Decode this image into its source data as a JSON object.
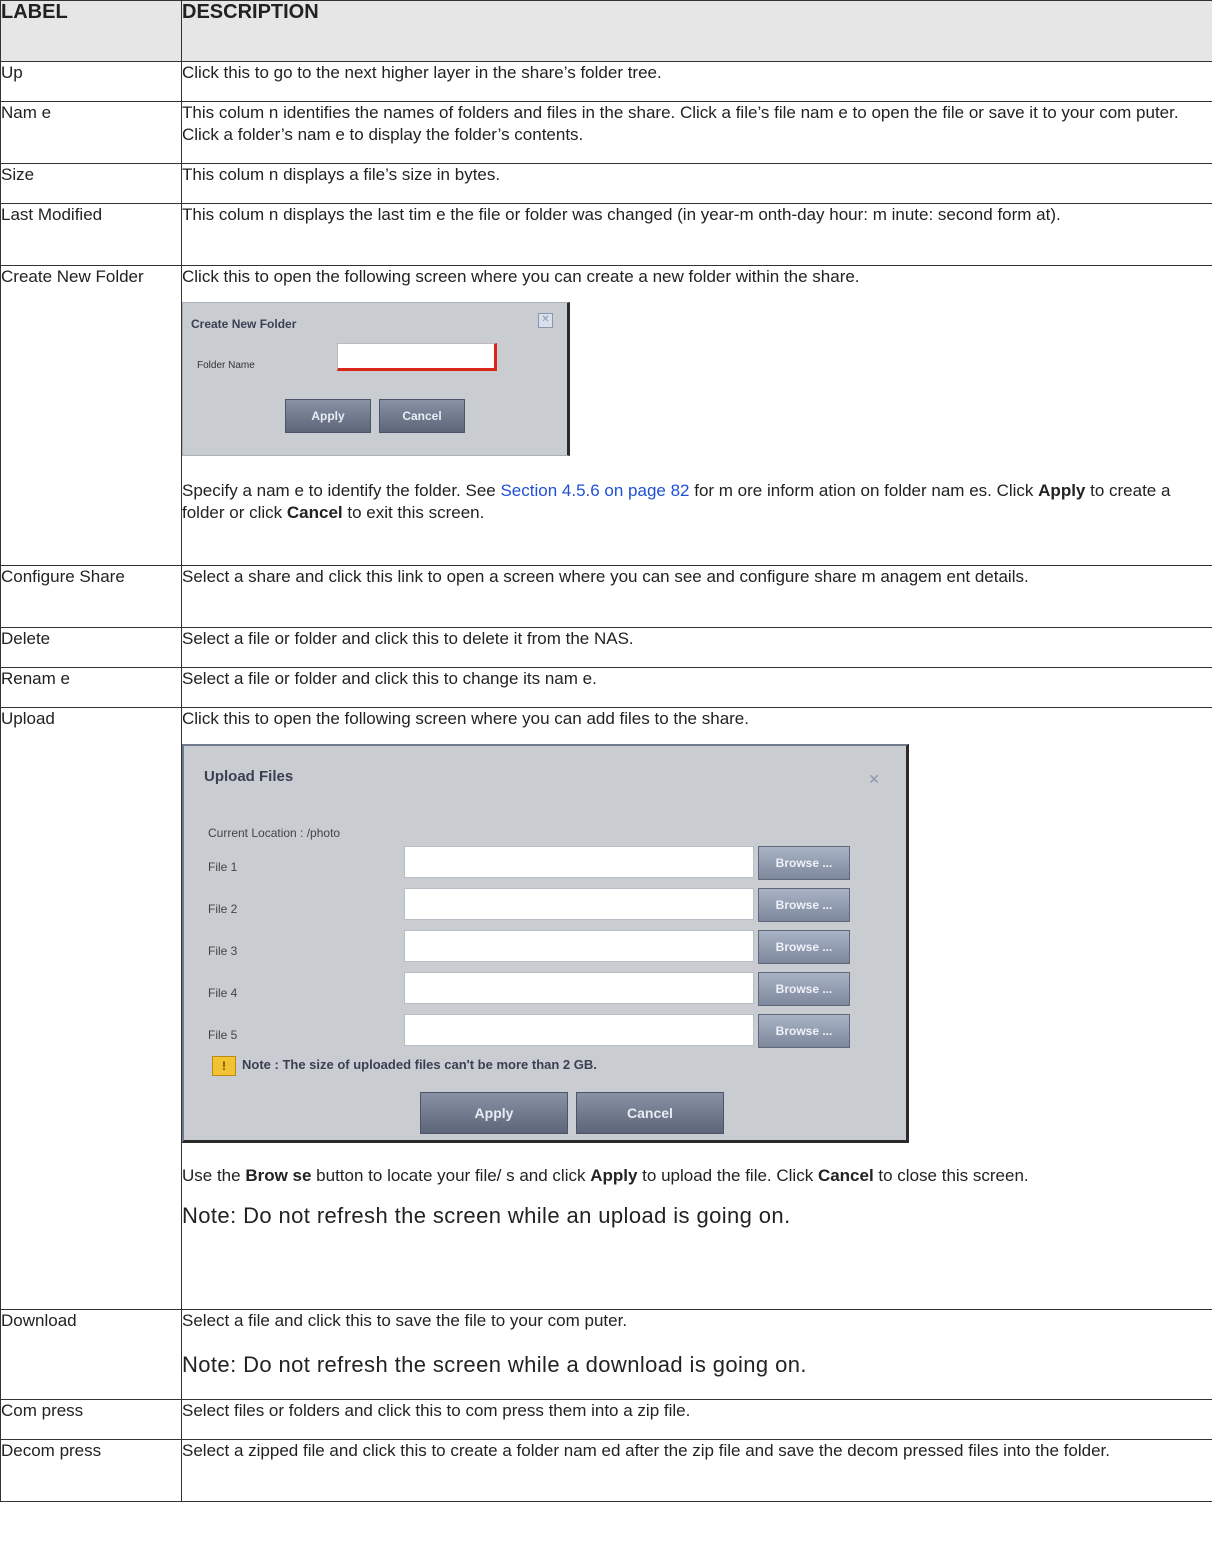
{
  "headers": {
    "label": "LABEL",
    "description": "DESCRIPTION"
  },
  "rows": {
    "up": {
      "label": "Up",
      "desc": "Click this to go to the next higher layer in the share’s folder tree."
    },
    "name": {
      "label": "Nam e",
      "desc": "This colum n identifies the names of folders and files in the share. Click a file’s file nam e to open the file or save it to your com puter. Click a folder’s nam e to display the folder’s contents."
    },
    "size": {
      "label": "Size",
      "desc": "This colum n displays a file’s size in bytes."
    },
    "last_modified": {
      "label": "Last Modified",
      "desc": "This colum n displays the last tim e the file or folder was changed (in year-m onth-day hour: m inute: second form at)."
    },
    "create_folder": {
      "label": "Create New Folder",
      "desc": "Click this to open the following screen where you can create a new folder within the share.",
      "dialog": {
        "title": "Create New Folder",
        "field_label": "Folder Name",
        "apply": "Apply",
        "cancel": "Cancel",
        "close": "✕"
      },
      "after_1": "Specify a nam e to identify the folder. See ",
      "link": "Section 4.5.6 on page 82",
      "after_2": " for m ore inform ation on folder nam es. Click ",
      "apply_bold": "Apply",
      "after_3": " to create a folder or click ",
      "cancel_bold": "Cancel",
      "after_4": " to exit this screen."
    },
    "configure_share": {
      "label": "Configure Share",
      "desc": "Select a share and click this link to open a screen where you can see and configure share m anagem ent details."
    },
    "delete": {
      "label": "Delete",
      "desc": "Select a file or folder and click this to delete it from the NAS."
    },
    "rename": {
      "label": "Renam e",
      "desc": "Select a file or folder and click this to change its nam e."
    },
    "upload": {
      "label": "Upload",
      "desc": "Click this to open the following screen where you can add files to the share.",
      "dialog": {
        "title": "Upload Files",
        "close": "✕",
        "location": "Current Location : /photo",
        "files": [
          "File 1",
          "File 2",
          "File 3",
          "File 4",
          "File 5"
        ],
        "browse": "Browse ...",
        "note": "Note : The size of uploaded files can't be more than 2 GB.",
        "note_icon": "!",
        "apply": "Apply",
        "cancel": "Cancel"
      },
      "after_1": "Use the ",
      "browse_bold": "Brow se",
      "after_2": " button to locate your file/ s and click ",
      "apply_bold": "Apply",
      "after_3": " to upload the file. Click ",
      "cancel_bold": "Cancel",
      "after_4": " to close this screen.",
      "note": "Note: Do not refresh the screen while an upload is going on."
    },
    "download": {
      "label": "Download",
      "desc": "Select a file and click this to save the file to your com puter.",
      "note": "Note: Do not refresh the screen while a download is going on."
    },
    "compress": {
      "label": "Com press",
      "desc": "Select files or folders and click this to com press them into a zip file."
    },
    "decompress": {
      "label": "Decom press",
      "desc": "Select a zipped file and click this to create a folder nam ed after the zip file and save the decom pressed files into the folder."
    }
  }
}
